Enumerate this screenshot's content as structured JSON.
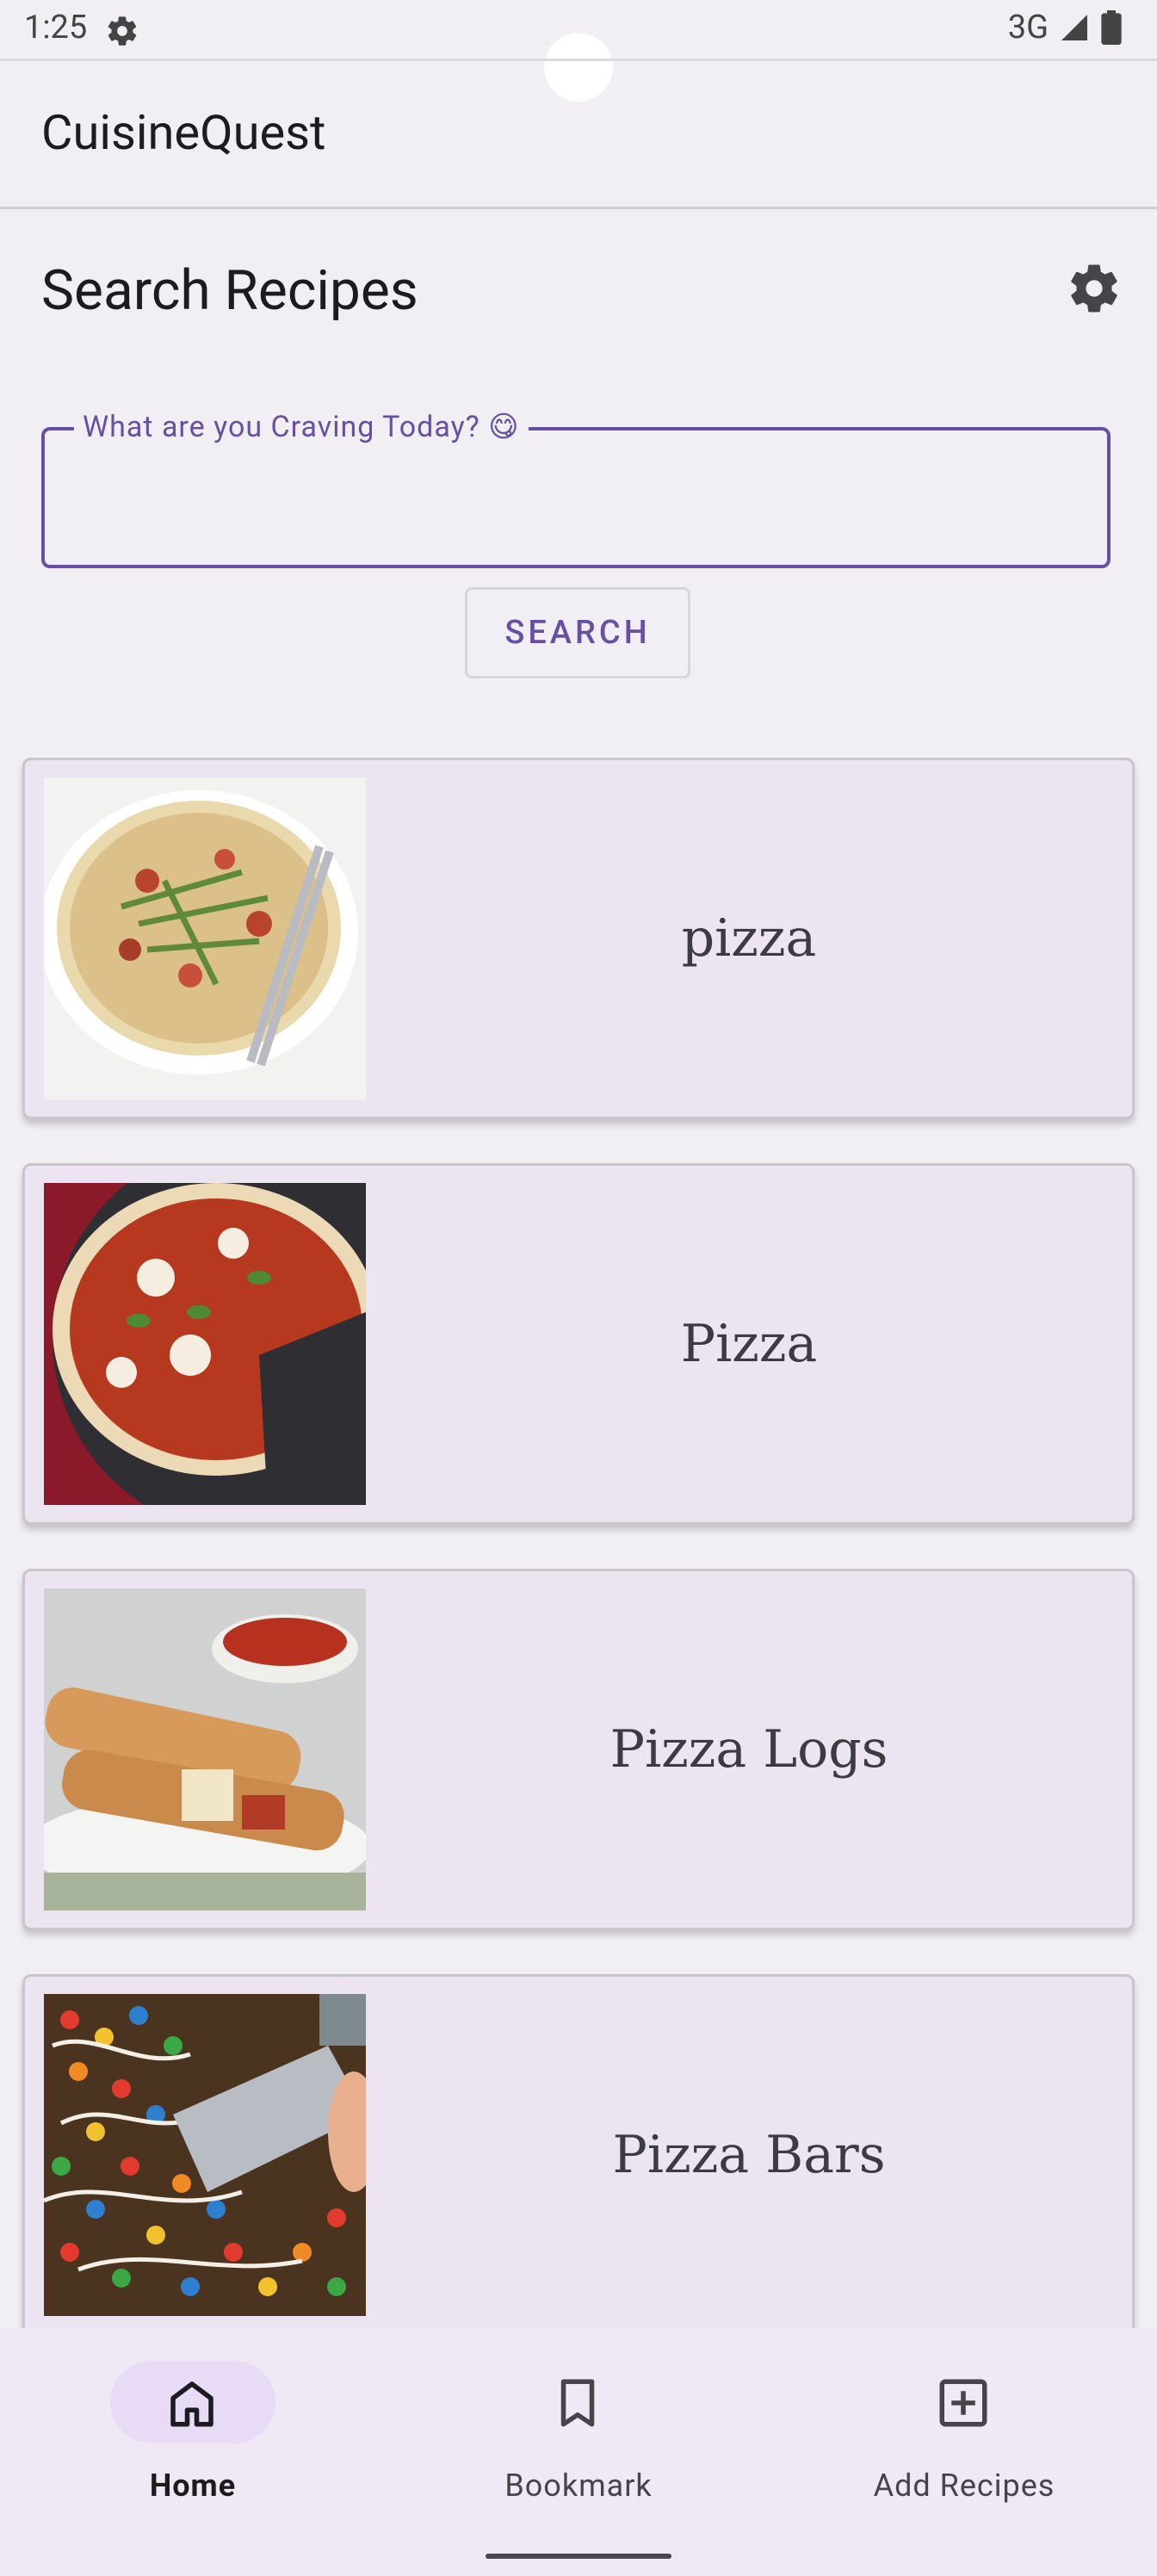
{
  "status_bar": {
    "time": "1:25",
    "network": "3G"
  },
  "app_bar": {
    "title": "CuisineQuest"
  },
  "header": {
    "title": "Search Recipes"
  },
  "search": {
    "label": "What are you Craving Today? 😋",
    "value": "",
    "button_label": "SEARCH"
  },
  "recipes": [
    {
      "title": "pizza"
    },
    {
      "title": "Pizza"
    },
    {
      "title": "Pizza Logs"
    },
    {
      "title": "Pizza Bars"
    }
  ],
  "bottom_nav": {
    "items": [
      {
        "label": "Home",
        "icon": "home-icon",
        "active": true
      },
      {
        "label": "Bookmark",
        "icon": "bookmark-icon",
        "active": false
      },
      {
        "label": "Add Recipes",
        "icon": "add-box-icon",
        "active": false
      }
    ]
  },
  "colors": {
    "accent": "#6750a4",
    "card_bg": "#ede4f2",
    "background": "#f2eff4",
    "nav_active_pill": "#e7dbf6"
  }
}
